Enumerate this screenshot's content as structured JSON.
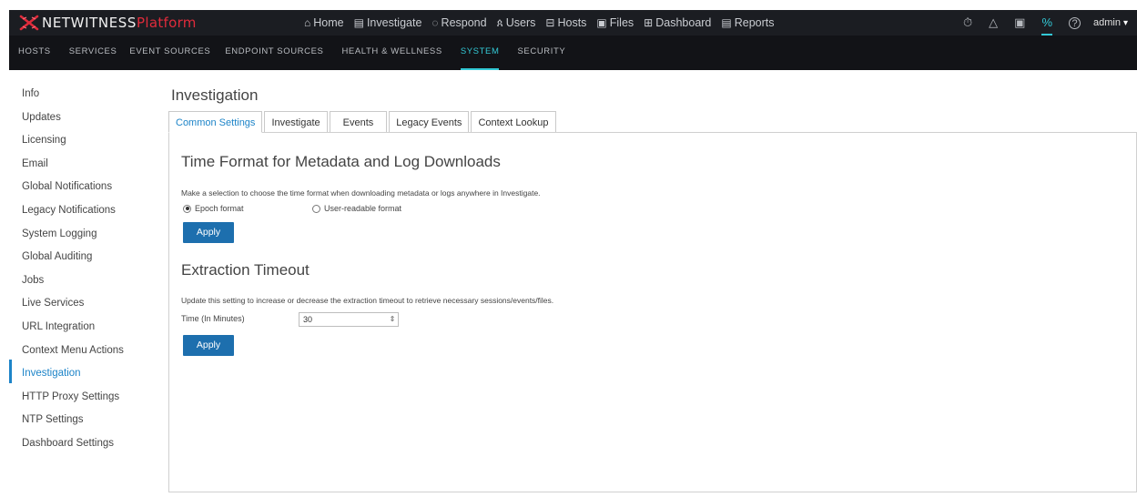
{
  "app": {
    "brand": "NETWITNESS",
    "brand_suffix": "Platform"
  },
  "main_nav": [
    {
      "icon": "home-icon",
      "glyph": "⌂",
      "label": "Home"
    },
    {
      "icon": "investigate-icon",
      "glyph": "▤",
      "label": "Investigate"
    },
    {
      "icon": "respond-icon",
      "glyph": "◌",
      "label": "Respond"
    },
    {
      "icon": "users-icon",
      "glyph": "ጰ",
      "label": "Users"
    },
    {
      "icon": "hosts-icon",
      "glyph": "⊟",
      "label": "Hosts"
    },
    {
      "icon": "files-icon",
      "glyph": "▣",
      "label": "Files"
    },
    {
      "icon": "dashboard-icon",
      "glyph": "⊞",
      "label": "Dashboard"
    },
    {
      "icon": "reports-icon",
      "glyph": "▤",
      "label": "Reports"
    }
  ],
  "right_nav": {
    "timer_icon": "⏱",
    "bell_icon": "△",
    "notes_icon": "▣",
    "admin_icon": "%",
    "help_icon": "?",
    "user": "admin",
    "caret": "▾"
  },
  "sub_nav": [
    {
      "label": "HOSTS",
      "active": false
    },
    {
      "label": "SERVICES",
      "active": false
    },
    {
      "label": "EVENT SOURCES",
      "active": false
    },
    {
      "label": "ENDPOINT SOURCES",
      "active": false
    },
    {
      "label": "HEALTH & WELLNESS",
      "active": false
    },
    {
      "label": "SYSTEM",
      "active": true
    },
    {
      "label": "SECURITY",
      "active": false
    }
  ],
  "sidebar": {
    "items": [
      {
        "label": "Info"
      },
      {
        "label": "Updates"
      },
      {
        "label": "Licensing"
      },
      {
        "label": "Email"
      },
      {
        "label": "Global Notifications"
      },
      {
        "label": "Legacy Notifications"
      },
      {
        "label": "System Logging"
      },
      {
        "label": "Global Auditing"
      },
      {
        "label": "Jobs"
      },
      {
        "label": "Live Services"
      },
      {
        "label": "URL Integration"
      },
      {
        "label": "Context Menu Actions"
      },
      {
        "label": "Investigation"
      },
      {
        "label": "HTTP Proxy Settings"
      },
      {
        "label": "NTP Settings"
      },
      {
        "label": "Dashboard Settings"
      }
    ],
    "active_index": 12
  },
  "page": {
    "title": "Investigation",
    "tabs": [
      {
        "label": "Common Settings"
      },
      {
        "label": "Investigate"
      },
      {
        "label": "Events"
      },
      {
        "label": "Legacy Events"
      },
      {
        "label": "Context Lookup"
      }
    ],
    "active_tab": 0
  },
  "time_format": {
    "heading": "Time Format for Metadata and Log Downloads",
    "description": "Make a selection to choose the time format when downloading metadata or logs anywhere in Investigate.",
    "options": [
      {
        "label": "Epoch format",
        "selected": true
      },
      {
        "label": "User-readable format",
        "selected": false
      }
    ],
    "apply_label": "Apply"
  },
  "extraction": {
    "heading": "Extraction Timeout",
    "description": "Update this setting to increase or decrease the extraction timeout to retrieve necessary sessions/events/files.",
    "field_label": "Time (In Minutes)",
    "field_value": "30",
    "spinner_glyph": "⇕",
    "apply_label": "Apply"
  },
  "colors": {
    "accent": "#33c9d6",
    "link": "#1d84c8",
    "button": "#1d6fae",
    "brand_red": "#e02b3b",
    "header_bg": "#1b1d22",
    "subnav_bg": "#121317"
  }
}
